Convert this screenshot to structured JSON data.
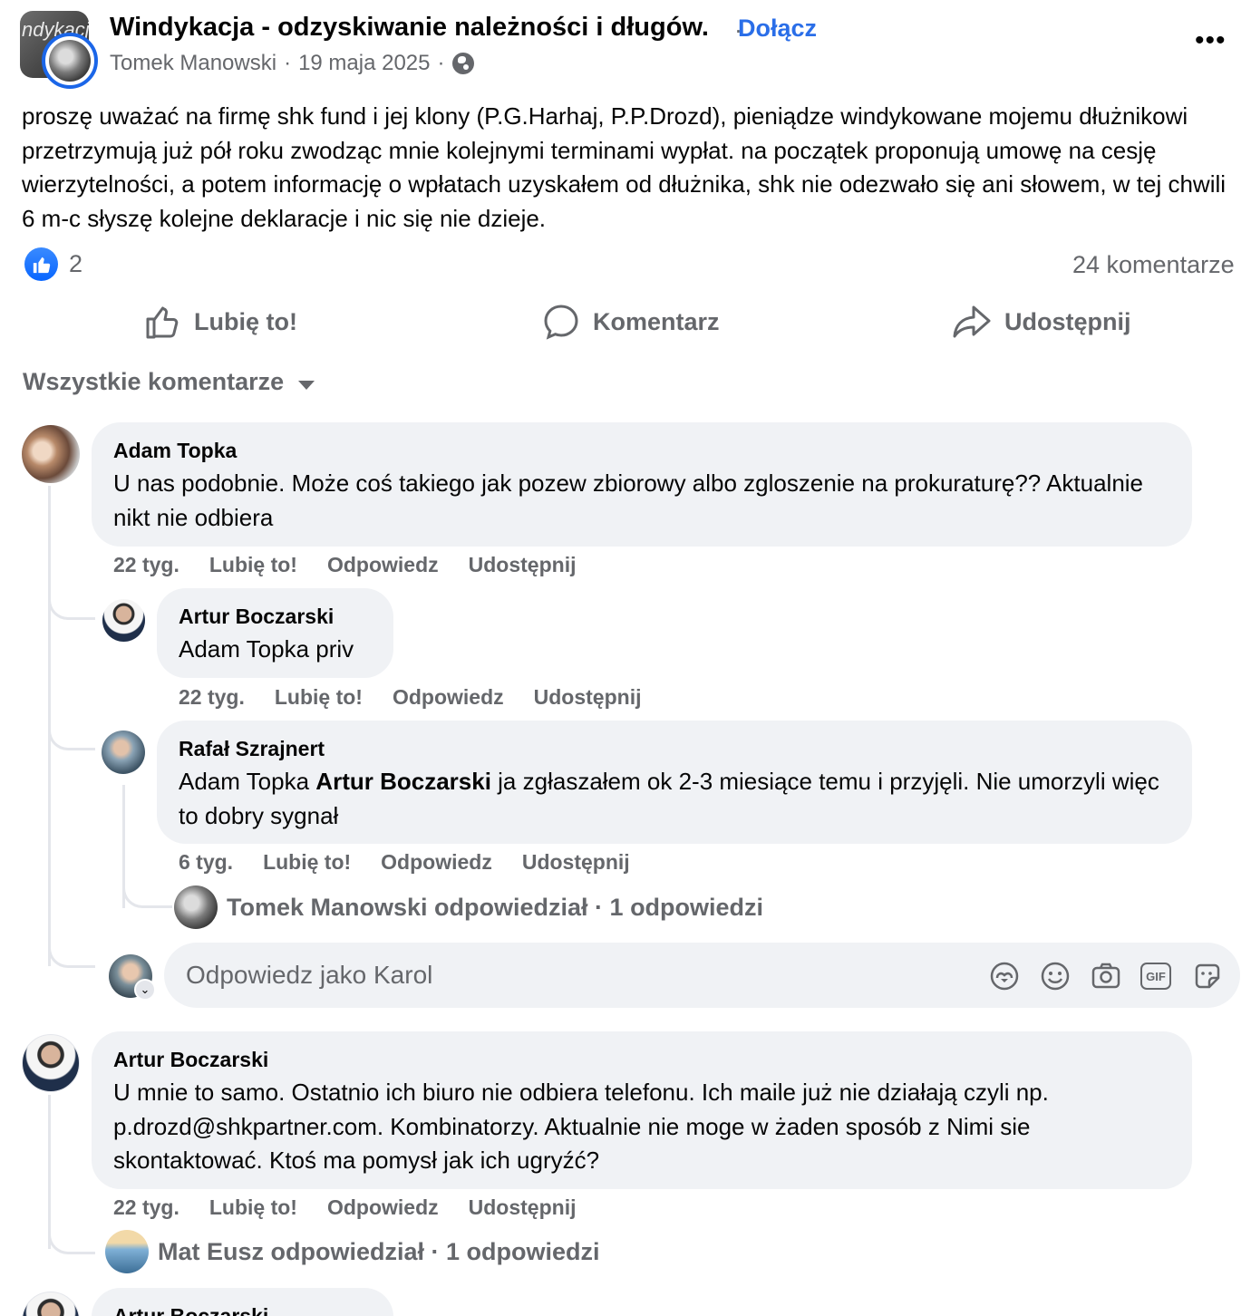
{
  "post": {
    "group_name": "Windykacja - odzyskiwanie należności i długów.",
    "group_avatar_text": "ndykacja",
    "join_label": "Dołącz",
    "author": "Tomek Manowski",
    "date": "19 maja 2025",
    "text": "proszę uważać na firmę shk fund i jej klony (P.G.Harhaj, P.P.Drozd), pieniądze windykowane mojemu dłużnikowi przetrzymują już pół roku zwodząc mnie kolejnymi terminami wypłat. na początek proponują umowę na cesję wierzytelności, a potem informację o wpłatach uzyskałem od dłużnika, shk nie odezwało się ani słowem, w tej chwili 6 m-c słyszę kolejne deklaracje i nic się nie dzieje.",
    "like_count": "2",
    "comment_count": "24 komentarze",
    "more": "•••"
  },
  "actions": {
    "like": "Lubię to!",
    "comment": "Komentarz",
    "share": "Udostępnij"
  },
  "sort_label": "Wszystkie komentarze",
  "comments": [
    {
      "name": "Adam Topka",
      "text": "U nas podobnie. Może coś takiego jak pozew zbiorowy albo zgloszenie na prokuraturę?? Aktualnie nikt nie odbiera",
      "time": "22 tyg.",
      "like": "Lubię to!",
      "reply": "Odpowiedz",
      "share": "Udostępnij",
      "replies": [
        {
          "name": "Artur Boczarski",
          "text": "Adam Topka priv",
          "time": "22 tyg.",
          "like": "Lubię to!",
          "reply": "Odpowiedz",
          "share": "Udostępnij"
        },
        {
          "name": "Rafał Szrajnert",
          "mention1": "Adam Topka",
          "mention2": "Artur Boczarski",
          "text": "ja zgłaszałem ok 2-3 miesiące temu i przyjęli. Nie umorzyli więc to dobry sygnał",
          "time": "6 tyg.",
          "like": "Lubię to!",
          "reply": "Odpowiedz",
          "share": "Udostępnij",
          "summary": "Tomek Manowski odpowiedział · 1 odpowiedzi"
        }
      ],
      "reply_placeholder": "Odpowiedz jako Karol"
    },
    {
      "name": "Artur Boczarski",
      "text": "U mnie to samo. Ostatnio ich biuro nie odbiera telefonu. Ich maile już nie działają czyli np. p.drozd@shkpartner.com. Kombinatorzy. Aktualnie nie moge w żaden sposób z Nimi sie skontaktować. Ktoś ma pomysł jak ich ugryźć?",
      "time": "22 tyg.",
      "like": "Lubię to!",
      "reply": "Odpowiedz",
      "share": "Udostępnij",
      "summary": "Mat Eusz odpowiedział · 1 odpowiedzi"
    },
    {
      "name": "Artur Boczarski"
    }
  ],
  "reply_tools": [
    "avatar-sticker-icon",
    "emoji-icon",
    "camera-icon",
    "gif-icon",
    "sticker-icon"
  ],
  "reply_tool_labels": {
    "gif": "GIF"
  },
  "colors": {
    "accent": "#0866ff",
    "link": "#2a6ee8",
    "secondary_text": "#65676b",
    "bubble": "#f0f2f5"
  }
}
